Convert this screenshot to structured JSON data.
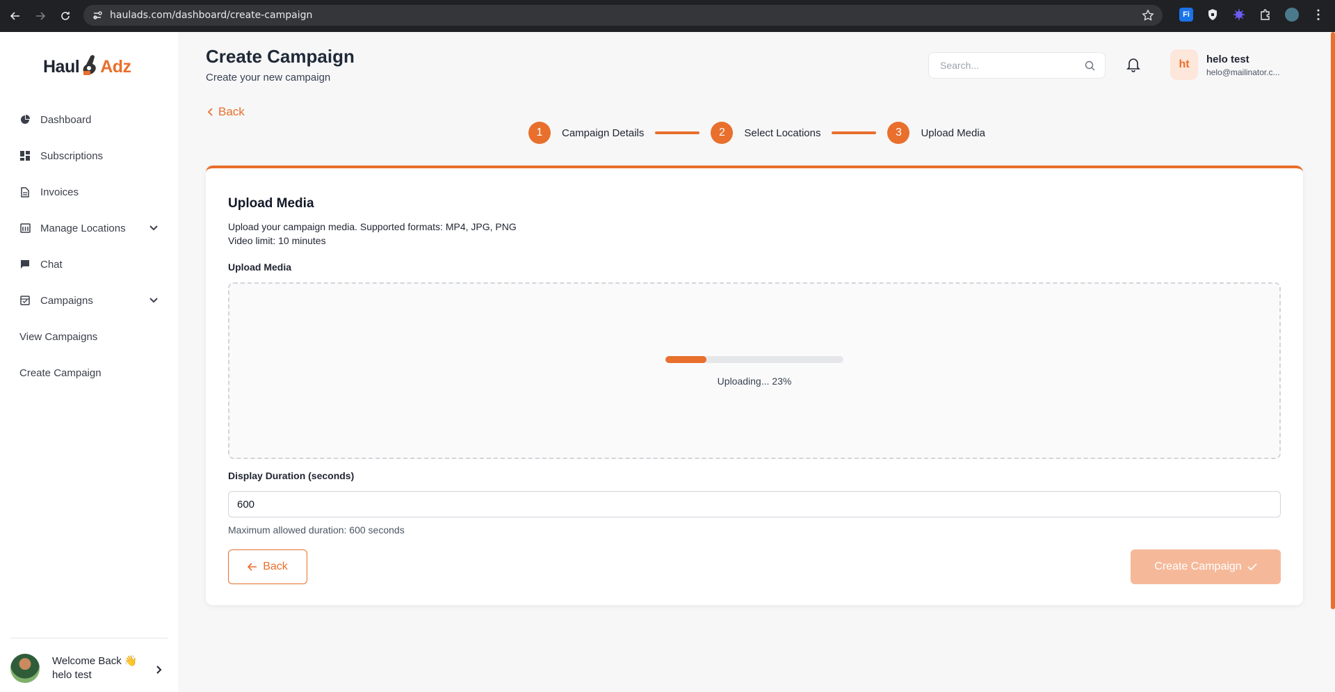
{
  "browser": {
    "url": "haulads.com/dashboard/create-campaign"
  },
  "brand": {
    "logo_left": "Haul",
    "logo_right": "Adz",
    "accent": "#e86f2c"
  },
  "sidebar": {
    "items": [
      {
        "label": "Dashboard",
        "icon": "pie-chart-icon"
      },
      {
        "label": "Subscriptions",
        "icon": "grid-icon"
      },
      {
        "label": "Invoices",
        "icon": "document-icon"
      },
      {
        "label": "Manage Locations",
        "icon": "building-icon"
      },
      {
        "label": "Chat",
        "icon": "chat-icon"
      },
      {
        "label": "Campaigns",
        "icon": "campaign-icon"
      },
      {
        "label": "View Campaigns"
      },
      {
        "label": "Create Campaign"
      }
    ],
    "footer": {
      "greeting": "Welcome Back 👋",
      "name": "helo test"
    }
  },
  "header": {
    "title": "Create Campaign",
    "subtitle": "Create your new campaign",
    "search_placeholder": "Search...",
    "user": {
      "initials": "ht",
      "name": "helo test",
      "email": "helo@mailinator.c..."
    }
  },
  "back_link": "Back",
  "steps": [
    {
      "number": "1",
      "label": "Campaign Details"
    },
    {
      "number": "2",
      "label": "Select Locations"
    },
    {
      "number": "3",
      "label": "Upload Media"
    }
  ],
  "card": {
    "title": "Upload Media",
    "desc_line1": "Upload your campaign media. Supported formats: MP4, JPG, PNG",
    "desc_line2": "Video limit: 10 minutes",
    "upload_label": "Upload Media",
    "upload_progress": 0.23,
    "upload_status": "Uploading... 23%",
    "duration_label": "Display Duration (seconds)",
    "duration_value": "600",
    "duration_hint": "Maximum allowed duration: 600 seconds",
    "back_button": "Back",
    "create_button": "Create Campaign"
  }
}
